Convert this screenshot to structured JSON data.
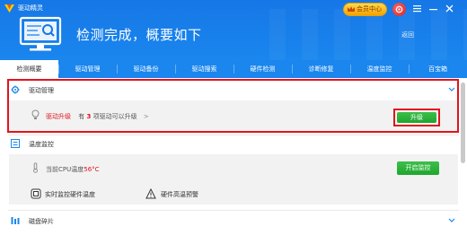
{
  "app": {
    "title": "驱动精灵",
    "member_label": "会员中心"
  },
  "hero": {
    "title": "检测完成，概要如下",
    "back_label": "返回"
  },
  "tabs": [
    {
      "label": "检测概要",
      "active": true
    },
    {
      "label": "驱动管理"
    },
    {
      "label": "驱动备份"
    },
    {
      "label": "驱动搜索"
    },
    {
      "label": "硬件检测"
    },
    {
      "label": "诊断修复"
    },
    {
      "label": "温度监控"
    },
    {
      "label": "百宝箱"
    }
  ],
  "driver_section": {
    "title": "驱动管理",
    "upgrade_label": "驱动升级",
    "text_prefix": "有",
    "count": "3",
    "text_suffix": "项驱动可以升级",
    "button_label": "升级"
  },
  "temp_section": {
    "title": "温度监控",
    "cpu_label": "当前CPU温度",
    "cpu_value": "56°C",
    "button_label": "开启监控",
    "item1": "实时监控硬件温度",
    "item2": "硬件高温预警"
  },
  "disk_section": {
    "title": "磁盘碎片"
  },
  "colors": {
    "accent": "#1a86ee",
    "highlight": "#e0141e",
    "green": "#1fa52e"
  }
}
